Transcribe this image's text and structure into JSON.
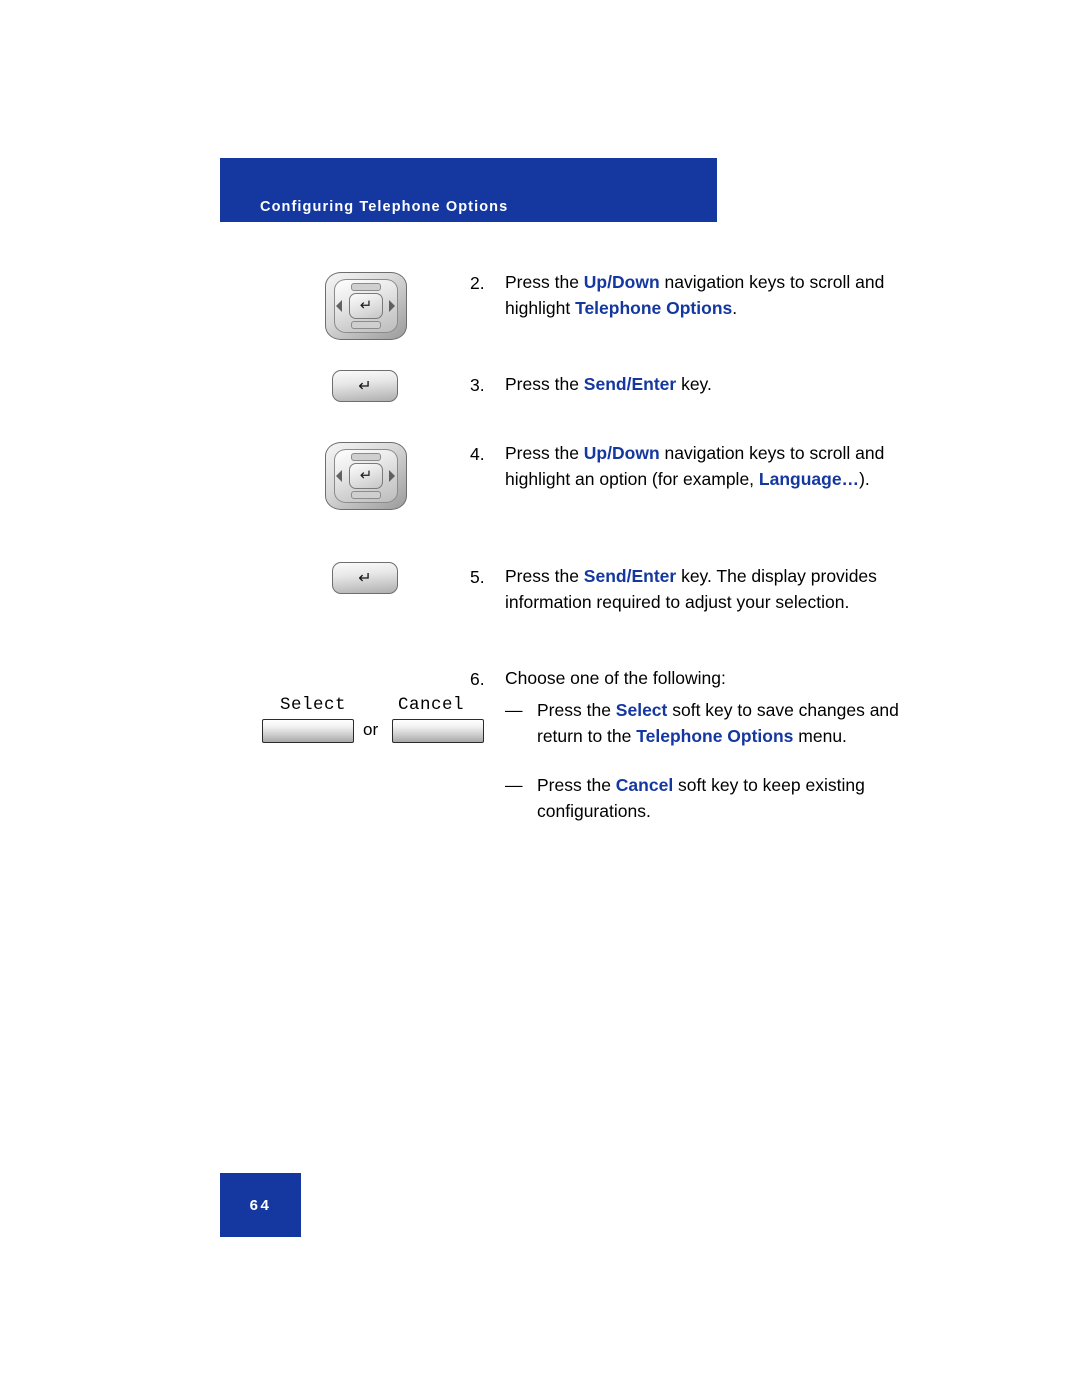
{
  "header": {
    "title": "Configuring Telephone Options",
    "band_color": "#1438a0"
  },
  "steps": [
    {
      "number": "2.",
      "icon": "navigation-keys-icon",
      "lines": [
        {
          "parts": [
            {
              "t": "Press the ",
              "b": false
            },
            {
              "t": "Up",
              "b": true
            },
            {
              "t": "/",
              "b": true,
              "slash": true
            },
            {
              "t": "Down",
              "b": true
            },
            {
              "t": " navigation keys to",
              "b": false
            }
          ]
        },
        {
          "parts": [
            {
              "t": "scroll and highlight ",
              "b": false
            },
            {
              "t": "Telephone Options",
              "b": true
            },
            {
              "t": ".",
              "b": false
            }
          ]
        }
      ]
    },
    {
      "number": "3.",
      "icon": "enter-key-icon",
      "lines": [
        {
          "parts": [
            {
              "t": "Press the ",
              "b": false
            },
            {
              "t": "Send",
              "b": true
            },
            {
              "t": "/",
              "b": true,
              "slash": true
            },
            {
              "t": "Enter",
              "b": true
            },
            {
              "t": " key.",
              "b": false
            }
          ]
        }
      ]
    },
    {
      "number": "4.",
      "icon": "navigation-keys-icon",
      "lines": [
        {
          "parts": [
            {
              "t": "Press the ",
              "b": false
            },
            {
              "t": "Up",
              "b": true
            },
            {
              "t": "/",
              "b": true,
              "slash": true
            },
            {
              "t": "Down",
              "b": true
            },
            {
              "t": " navigation keys",
              "b": false
            }
          ]
        },
        {
          "parts": [
            {
              "t": "to scroll and highlight an option",
              "b": false
            }
          ]
        },
        {
          "parts": [
            {
              "t": "(for example, ",
              "b": false
            },
            {
              "t": "Language…",
              "b": true
            },
            {
              "t": ").",
              "b": false
            }
          ]
        }
      ]
    },
    {
      "number": "5.",
      "icon": "enter-key-icon",
      "lines": [
        {
          "parts": [
            {
              "t": "Press the ",
              "b": false
            },
            {
              "t": "Send",
              "b": true
            },
            {
              "t": "/",
              "b": true,
              "slash": true
            },
            {
              "t": "Enter",
              "b": true
            },
            {
              "t": " key. The display",
              "b": false
            }
          ]
        },
        {
          "parts": [
            {
              "t": "provides information required to adjust",
              "b": false
            }
          ]
        },
        {
          "parts": [
            {
              "t": "your selection.",
              "b": false
            }
          ]
        }
      ]
    },
    {
      "number": "6.",
      "icon": "",
      "lines": [
        {
          "parts": [
            {
              "t": "Choose one of the following:",
              "b": false
            }
          ]
        }
      ]
    }
  ],
  "softkeys": {
    "select_label": "Select",
    "cancel_label": "Cancel",
    "or_label": "or"
  },
  "bullets": [
    {
      "dash": "—",
      "lines": [
        {
          "parts": [
            {
              "t": "Press the ",
              "b": false
            },
            {
              "t": "Select",
              "b": true
            },
            {
              "t": " soft key to save",
              "b": false
            }
          ]
        },
        {
          "parts": [
            {
              "t": "changes and return to the",
              "b": false
            }
          ]
        },
        {
          "parts": [
            {
              "t": "Telephone Options",
              "b": true
            },
            {
              "t": " menu.",
              "b": false
            }
          ]
        }
      ]
    },
    {
      "dash": "—",
      "lines": [
        {
          "parts": [
            {
              "t": "Press the ",
              "b": false
            },
            {
              "t": "Cancel",
              "b": true
            },
            {
              "t": " soft key to keep",
              "b": false
            }
          ]
        },
        {
          "parts": [
            {
              "t": "existing configurations.",
              "b": false
            }
          ]
        }
      ]
    }
  ],
  "footer": {
    "page_number": "64"
  },
  "glyphs": {
    "enter_arrow": "↵"
  }
}
